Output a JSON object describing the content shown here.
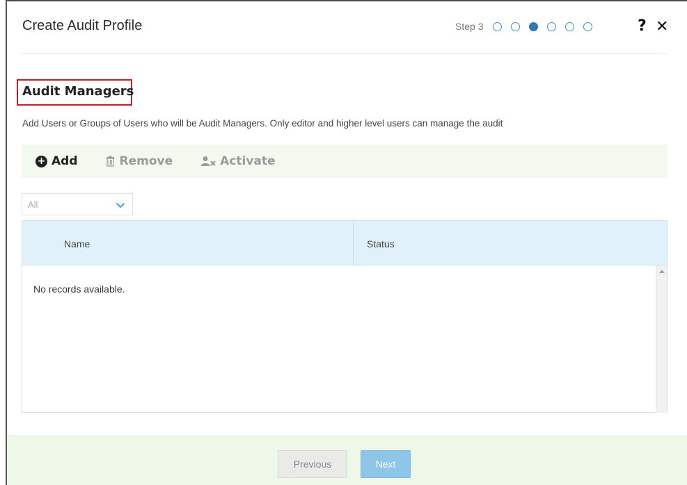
{
  "dialog": {
    "title": "Create Audit Profile",
    "help_icon": "question-mark-icon",
    "close_icon": "close-icon"
  },
  "stepper": {
    "label": "Step 3",
    "total_steps": 6,
    "current_step": 3
  },
  "section": {
    "title": "Audit Managers",
    "description": "Add Users or Groups of Users who will be Audit Managers. Only editor and higher level users can manage the audit"
  },
  "toolbar": {
    "add_label": "Add",
    "remove_label": "Remove",
    "activate_label": "Activate"
  },
  "filter": {
    "selected": "All"
  },
  "grid": {
    "columns": [
      "Name",
      "Status"
    ],
    "rows": [],
    "empty_message": "No records available."
  },
  "footer": {
    "previous_label": "Previous",
    "next_label": "Next"
  },
  "colors": {
    "accent": "#2f7ab6",
    "highlight_border": "#c41e24",
    "toolbar_bg": "#f3f9ee",
    "header_bg": "#e1f1fb",
    "footer_bg": "#eef7e8",
    "next_button": "#8ec5e8"
  }
}
